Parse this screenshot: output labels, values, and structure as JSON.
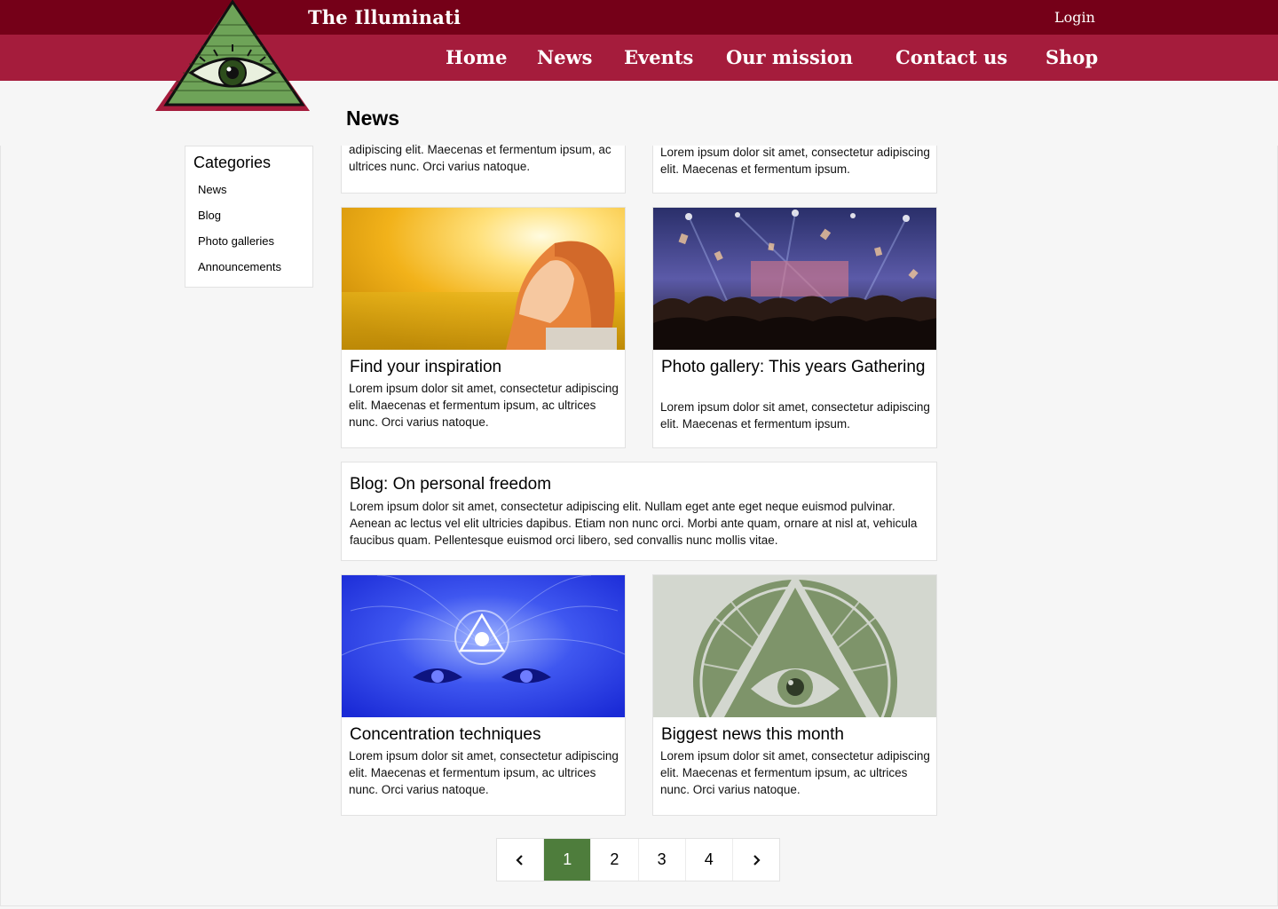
{
  "header": {
    "brand": "The Illuminati",
    "login": "Login",
    "nav": [
      "Home",
      "News",
      "Events",
      "Our mission",
      "Contact us",
      "Shop"
    ]
  },
  "page": {
    "title": "News"
  },
  "sidebar": {
    "title": "Categories",
    "items": [
      "News",
      "Blog",
      "Photo galleries",
      "Announcements"
    ]
  },
  "cards": {
    "top_left_text": "adipiscing elit. Maecenas et fermentum ipsum, ac ultrices nunc. Orci varius natoque.",
    "top_right_text": "Lorem ipsum dolor sit amet, consectetur adipiscing elit. Maecenas et fermentum ipsum.",
    "inspiration": {
      "title": "Find your inspiration",
      "text": "Lorem ipsum dolor sit amet, consectetur adipiscing elit. Maecenas et fermentum ipsum, ac ultrices nunc. Orci varius natoque."
    },
    "gallery": {
      "title": "Photo gallery: This years Gathering",
      "text": "Lorem ipsum dolor sit amet, consectetur adipiscing elit. Maecenas et fermentum ipsum."
    },
    "blog": {
      "title": "Blog: On personal freedom",
      "text": "Lorem ipsum dolor sit amet, consectetur adipiscing elit. Nullam eget ante eget neque euismod pulvinar. Aenean ac lectus vel elit ultricies dapibus. Etiam non nunc orci. Morbi ante quam, ornare at nisl at, vehicula faucibus quam. Pellentesque euismod orci libero, sed convallis nunc mollis vitae."
    },
    "concentration": {
      "title": "Concentration techniques",
      "text": "Lorem ipsum dolor sit amet, consectetur adipiscing elit. Maecenas et fermentum ipsum, ac ultrices nunc. Orci varius natoque."
    },
    "biggest": {
      "title": "Biggest news this month",
      "text": "Lorem ipsum dolor sit amet, consectetur adipiscing elit. Maecenas et fermentum ipsum, ac ultrices nunc. Orci varius natoque."
    }
  },
  "pagination": {
    "prev_icon": "chevron-left-icon",
    "next_icon": "chevron-right-icon",
    "pages": [
      "1",
      "2",
      "3",
      "4"
    ],
    "active": "1"
  },
  "colors": {
    "topbar": "#750018",
    "navbar": "#a51c3c",
    "accent_green": "#4e7d3c"
  }
}
